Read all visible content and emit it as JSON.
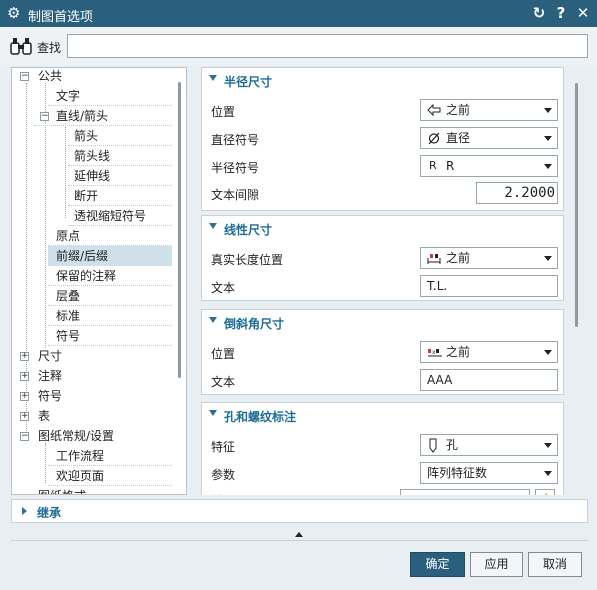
{
  "window": {
    "title": "制图首选项",
    "icon": "gear-icon",
    "title_color": "#2a5f7e"
  },
  "search": {
    "label": "查找",
    "value": "",
    "placeholder": ""
  },
  "tree": {
    "items": [
      {
        "label": "公共",
        "level": 0,
        "state": "expanded"
      },
      {
        "label": "文字",
        "level": 1
      },
      {
        "label": "直线/箭头",
        "level": 1,
        "state": "expanded"
      },
      {
        "label": "箭头",
        "level": 2
      },
      {
        "label": "箭头线",
        "level": 2
      },
      {
        "label": "延伸线",
        "level": 2
      },
      {
        "label": "断开",
        "level": 2
      },
      {
        "label": "透视缩短符号",
        "level": 2
      },
      {
        "label": "原点",
        "level": 1
      },
      {
        "label": "前缀/后缀",
        "level": 1,
        "selected": true
      },
      {
        "label": "保留的注释",
        "level": 1
      },
      {
        "label": "层叠",
        "level": 1
      },
      {
        "label": "标准",
        "level": 1
      },
      {
        "label": "符号",
        "level": 1
      },
      {
        "label": "尺寸",
        "level": 0,
        "state": "collapsed"
      },
      {
        "label": "注释",
        "level": 0,
        "state": "collapsed"
      },
      {
        "label": "符号",
        "level": 0,
        "state": "collapsed"
      },
      {
        "label": "表",
        "level": 0,
        "state": "collapsed"
      },
      {
        "label": "图纸常规/设置",
        "level": 0,
        "state": "expanded"
      },
      {
        "label": "工作流程",
        "level": 1
      },
      {
        "label": "欢迎页面",
        "level": 1
      },
      {
        "label": "图纸格式",
        "level": 0
      }
    ]
  },
  "sections": {
    "radius": {
      "title": "半径尺寸",
      "position_label": "位置",
      "position_value": "之前",
      "position_icon": "arrow-left-outline-icon",
      "dia_label": "直径符号",
      "dia_value": "直径",
      "dia_icon": "diameter-icon",
      "rad_label": "半径符号",
      "rad_value": "R",
      "rad_icon_text": "R",
      "gap_label": "文本间隙",
      "gap_value": "2.2000"
    },
    "linear": {
      "title": "线性尺寸",
      "true_len_label": "真实长度位置",
      "true_len_value": "之前",
      "true_len_icon": "dimension-prefix-icon",
      "text_label": "文本",
      "text_value": "T.L."
    },
    "chamfer": {
      "title": "倒斜角尺寸",
      "position_label": "位置",
      "position_value": "之前",
      "position_icon": "chamfer-prefix-icon",
      "text_label": "文本",
      "text_value": "AAA"
    },
    "hole": {
      "title": "孔和螺纹标注",
      "feature_label": "特征",
      "feature_value": "孔",
      "feature_icon": "hole-icon",
      "param_label": "参数",
      "param_value": "阵列特征数",
      "prefix_label": "前缀"
    }
  },
  "inherit": {
    "label": "继承"
  },
  "buttons": {
    "ok": "确定",
    "apply": "应用",
    "cancel": "取消"
  }
}
